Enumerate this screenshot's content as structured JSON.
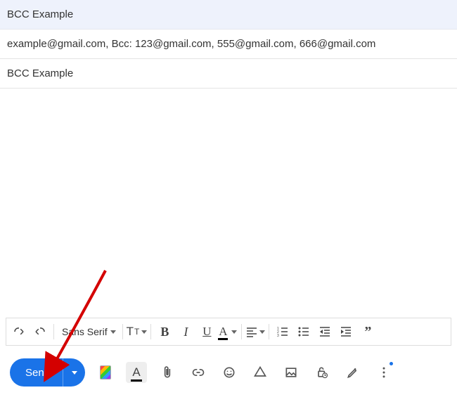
{
  "subject_header": "BCC Example",
  "recipients_line": "example@gmail.com, Bcc: 123@gmail.com, 555@gmail.com, 666@gmail.com",
  "subject_field": "BCC Example",
  "format_toolbar": {
    "font_family": "Sans Serif"
  },
  "send_button": {
    "label": "Send"
  }
}
